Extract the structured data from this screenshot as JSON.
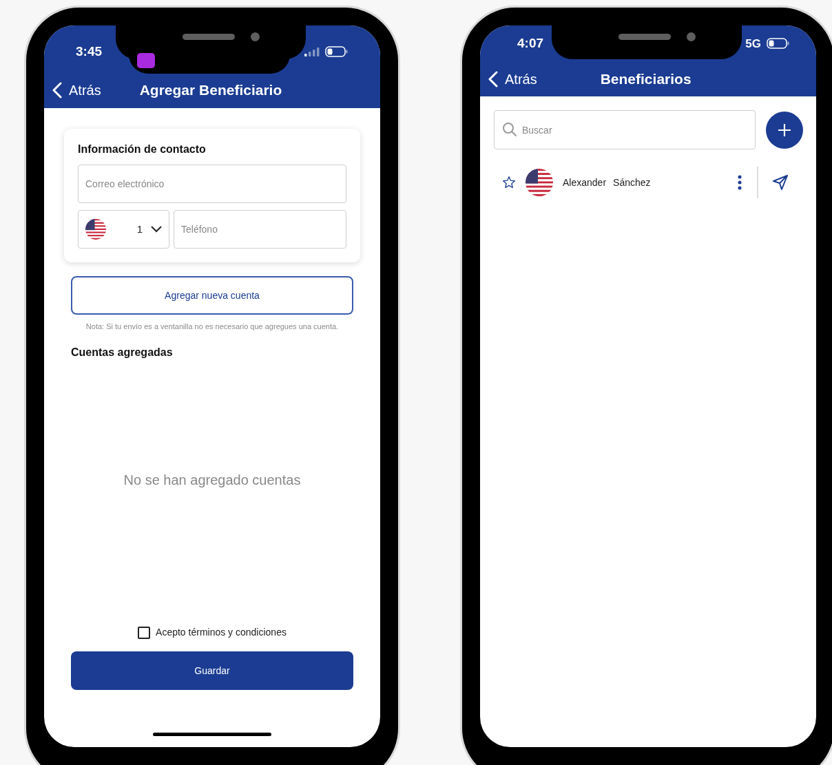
{
  "add_beneficiary_screen": {
    "status_bar": {
      "time": "3:45"
    },
    "nav": {
      "back": "Atrás",
      "title": "Agregar Beneficiario"
    },
    "contact_card": {
      "title": "Información de contacto",
      "email": {
        "placeholder": "Correo electrónico"
      },
      "country_code": "1",
      "phone": {
        "placeholder": "Teléfono"
      }
    },
    "add_account_button": "Agregar nueva cuenta",
    "note": "Nota: Si tu envío es a ventanilla no es necesario que agregues una cuenta.",
    "accounts_heading": "Cuentas agregadas",
    "empty_message": "No se han agregado cuentas",
    "terms": {
      "label": "Acepto términos y condiciones",
      "checked": false
    },
    "save_button": "Guardar"
  },
  "beneficiaries_screen": {
    "status_bar": {
      "time": "4:07",
      "network": "5G"
    },
    "nav": {
      "back": "Atrás",
      "title": "Beneficiarios"
    },
    "search": {
      "placeholder": "Buscar"
    },
    "beneficiaries": [
      {
        "first_name": "Alexander",
        "last_name": "Sánchez",
        "favorite": false
      }
    ]
  }
}
